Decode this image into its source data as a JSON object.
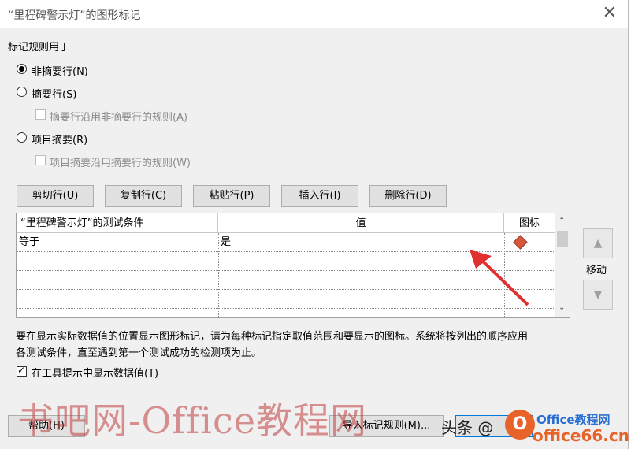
{
  "window": {
    "title": "“里程碑警示灯”的图形标记",
    "close_glyph": "✕"
  },
  "apply_rules": {
    "label": "标记规则用于",
    "option_nonsummary": "非摘要行(N)",
    "option_summary": "摘要行(S)",
    "chk_summary_uses_nonsummary": "摘要行沿用非摘要行的规则(A)",
    "option_project_summary": "项目摘要(R)",
    "chk_project_uses_summary": "项目摘要沿用摘要行的规则(W)",
    "selected": "非摘要行(N)"
  },
  "row_buttons": {
    "cut": "剪切行(U)",
    "copy": "复制行(C)",
    "paste": "粘贴行(P)",
    "insert": "插入行(I)",
    "delete": "删除行(D)"
  },
  "grid": {
    "headers": [
      "“里程碑警示灯”的测试条件",
      "值",
      "图标"
    ],
    "rows": [
      {
        "condition": "等于",
        "value": "是",
        "icon": "red-diamond-icon"
      }
    ]
  },
  "move": {
    "label": "移动",
    "up_glyph": "▲",
    "down_glyph": "▼"
  },
  "description": {
    "line1": "要在显示实际数据值的位置显示图形标记，请为每种标记指定取值范围和要显示的图标。系统将按列出的顺序应用",
    "line2": "各测试条件，直至遇到第一个测试成功的检测项为止。"
  },
  "tooltip_checkbox": {
    "label": "在工具提示中显示数据值(T)",
    "checked": true
  },
  "bottom_buttons": {
    "help": "帮助(H)",
    "import": "导入标记规则(M)..."
  },
  "watermark": {
    "main": "书吧网-Office教程网",
    "toutiao": "头条 @",
    "logo_glyph": "O",
    "site_top": "Office教程网",
    "site_bottom": "office66.cn"
  },
  "colors": {
    "diamond": "#d6573b",
    "arrow": "#e03030"
  }
}
